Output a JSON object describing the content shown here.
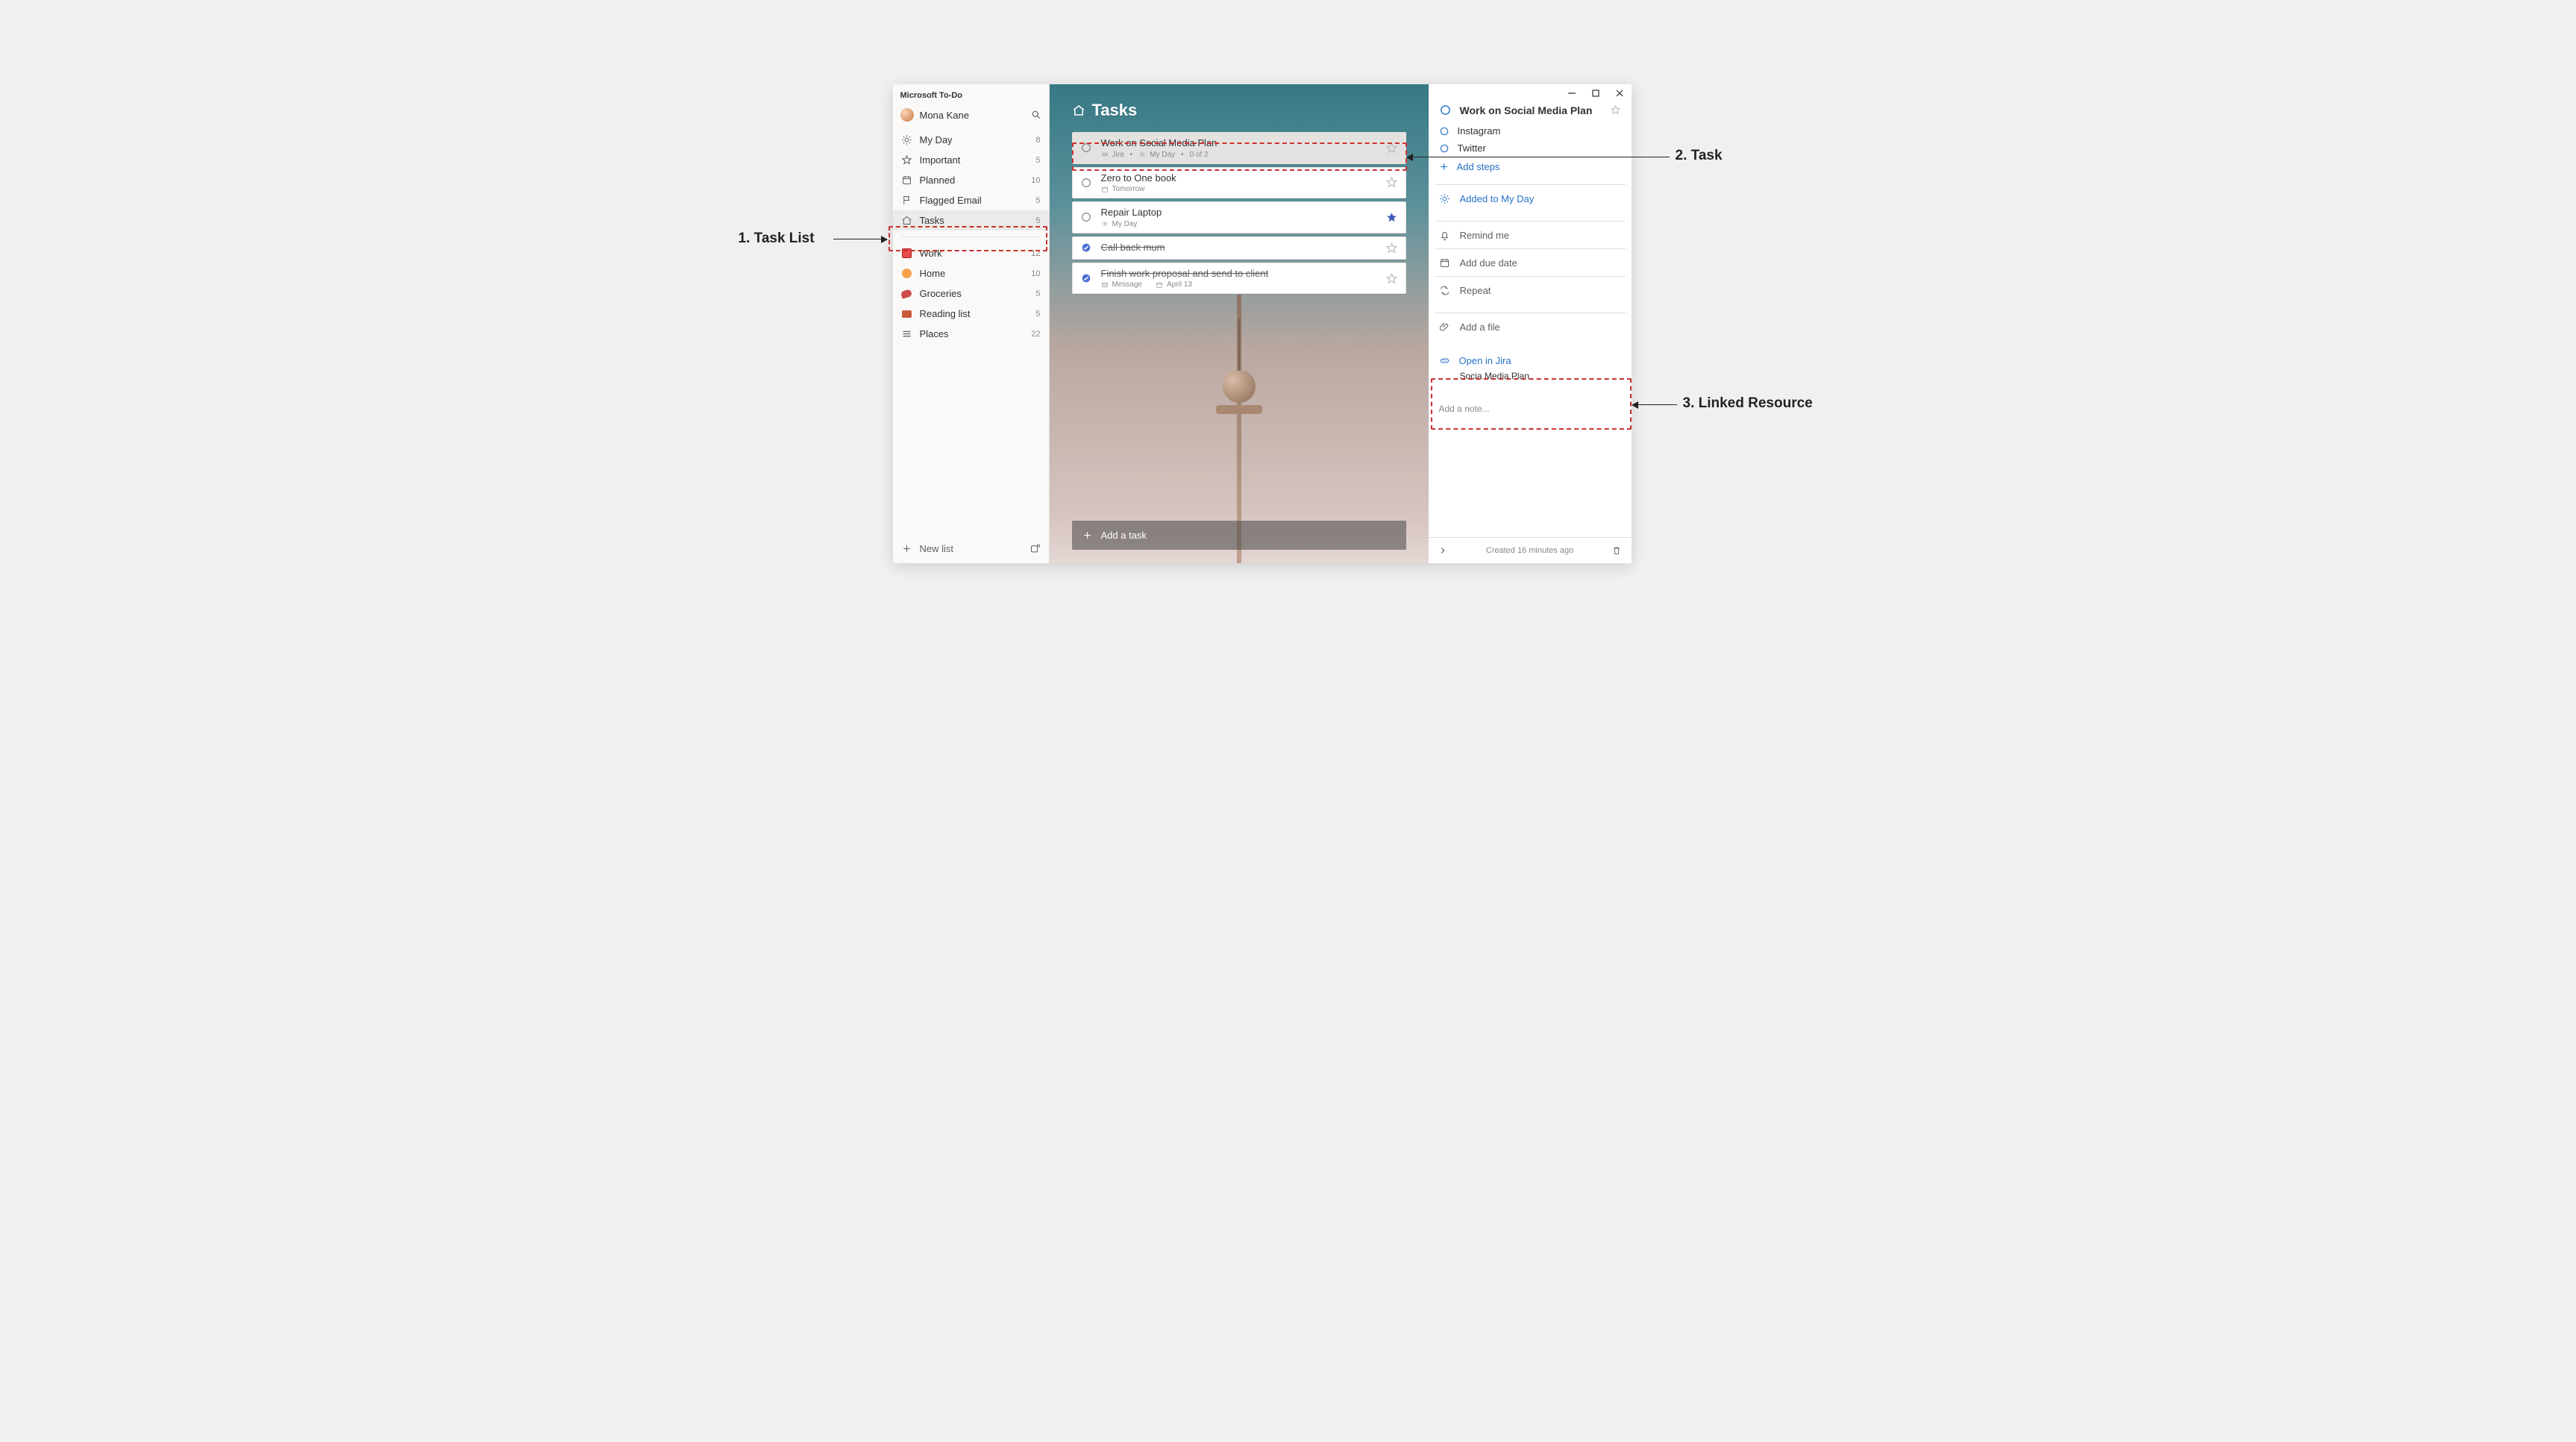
{
  "app": {
    "title": "Microsoft To-Do"
  },
  "user": {
    "name": "Mona Kane"
  },
  "sidebar": {
    "smart_lists": [
      {
        "icon": "sun",
        "label": "My Day",
        "count": "8"
      },
      {
        "icon": "star",
        "label": "Important",
        "count": "5"
      },
      {
        "icon": "calendar",
        "label": "Planned",
        "count": "10"
      },
      {
        "icon": "flag",
        "label": "Flagged Email",
        "count": "5"
      },
      {
        "icon": "home",
        "label": "Tasks",
        "count": "5"
      }
    ],
    "custom_lists": [
      {
        "icon": "work",
        "label": "Work",
        "count": "12"
      },
      {
        "icon": "home",
        "label": "Home",
        "count": "10"
      },
      {
        "icon": "groceries",
        "label": "Groceries",
        "count": "5"
      },
      {
        "icon": "reading",
        "label": "Reading list",
        "count": "5"
      },
      {
        "icon": "lines",
        "label": "Places",
        "count": "22"
      }
    ],
    "new_list_label": "New list"
  },
  "main": {
    "title": "Tasks",
    "tasks": [
      {
        "title": "Work on Social Media Plan",
        "completed": false,
        "starred": false,
        "selected": true,
        "meta": {
          "link": "Jira",
          "myday": "My Day",
          "progress": "0 of 2"
        }
      },
      {
        "title": "Zero to One book",
        "completed": false,
        "starred": false,
        "meta": {
          "due": "Tomorrow"
        }
      },
      {
        "title": "Repair Laptop",
        "completed": false,
        "starred": true,
        "meta": {
          "myday": "My Day"
        }
      },
      {
        "title": "Call back mum",
        "completed": true,
        "starred": false
      },
      {
        "title": "Finish work proposal and send to client",
        "completed": true,
        "starred": false,
        "meta": {
          "message": "Message",
          "date": "April 13"
        }
      }
    ],
    "add_task_placeholder": "Add a task"
  },
  "details": {
    "title": "Work on Social Media Plan",
    "steps": [
      {
        "label": "Instagram",
        "completed": false
      },
      {
        "label": "Twitter",
        "completed": false
      }
    ],
    "add_steps_label": "Add steps",
    "my_day_label": "Added to My Day",
    "remind_label": "Remind me",
    "due_label": "Add due date",
    "repeat_label": "Repeat",
    "add_file_label": "Add a file",
    "linked": {
      "open_label": "Open in Jira",
      "sub_label": "Socia Media Plan"
    },
    "note_placeholder": "Add a note...",
    "footer_text": "Created 16 minutes ago"
  },
  "callouts": {
    "c1": "1. Task List",
    "c2": "2. Task",
    "c3": "3. Linked Resource"
  }
}
